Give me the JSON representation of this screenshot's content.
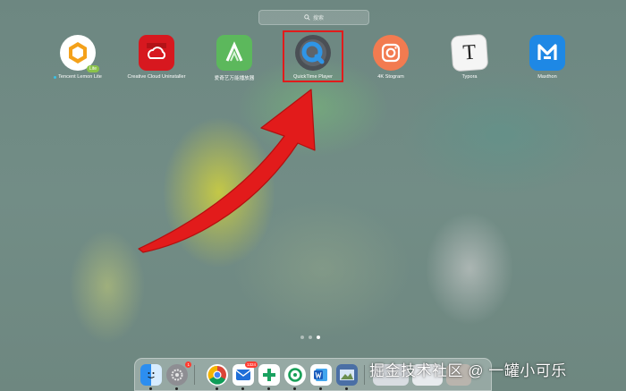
{
  "search": {
    "placeholder": "搜索"
  },
  "apps": [
    {
      "label": "Tencent Lemon Lite",
      "badge": "Lite",
      "icon": "lemon-icon",
      "new": true
    },
    {
      "label": "Creative Cloud Uninstaller",
      "icon": "creative-cloud-icon"
    },
    {
      "label": "爱奇艺万能播放器",
      "icon": "iqiyi-player-icon"
    },
    {
      "label": "QuickTime Player",
      "icon": "quicktime-icon"
    },
    {
      "label": "4K Stogram",
      "icon": "stogram-icon"
    },
    {
      "label": "Typora",
      "glyph": "T",
      "icon": "typora-icon"
    },
    {
      "label": "Maxthon",
      "icon": "maxthon-icon"
    }
  ],
  "dock": {
    "settings_badge": "1",
    "mail_badge": "1324"
  },
  "colors": {
    "highlight": "#e21b1b",
    "arrow": "#e21b1b",
    "background": "#6f8a83"
  },
  "watermark": "掘金技术社区 @ 一罐小可乐"
}
